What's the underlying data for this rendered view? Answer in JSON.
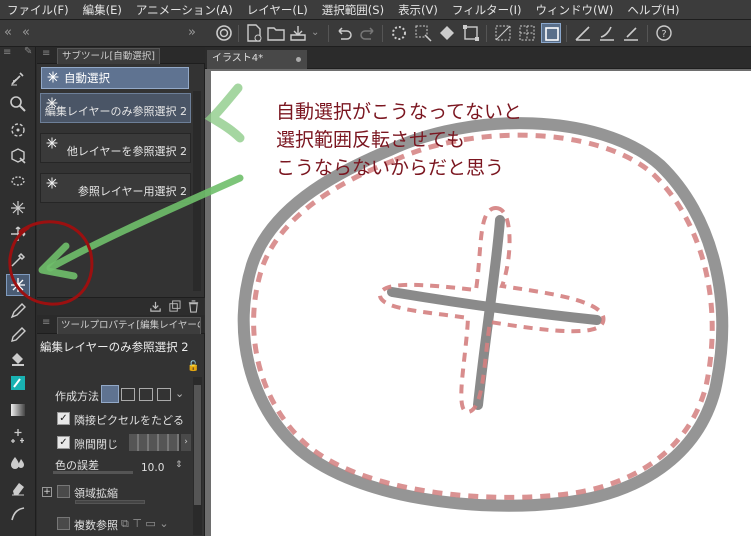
{
  "menu": [
    "ファイル(F)",
    "編集(E)",
    "アニメーション(A)",
    "レイヤー(L)",
    "選択範囲(S)",
    "表示(V)",
    "フィルター(I)",
    "ウィンドウ(W)",
    "ヘルプ(H)"
  ],
  "subtool_panel": {
    "tab_label": "サブツール[自動選択]",
    "group_label": "自動選択",
    "items": [
      {
        "label": "編集レイヤーのみ参照選択 2",
        "selected": true
      },
      {
        "label": "他レイヤーを参照選択 2",
        "selected": false
      },
      {
        "label": "参照レイヤー用選択 2",
        "selected": false
      }
    ]
  },
  "tool_property": {
    "tab_label": "ツールプロパティ[編集レイヤーの",
    "title": "編集レイヤーのみ参照選択 2",
    "mode_label": "作成方法",
    "follow_adjacent_label": "隣接ピクセルをたどる",
    "follow_adjacent_checked": true,
    "close_gap_label": "隙間閉じ",
    "close_gap_checked": true,
    "color_margin_label": "色の誤差",
    "color_margin_value": "10.0",
    "expand_area_label": "領域拡縮",
    "expand_area_checked": false,
    "multi_ref_label": "複数参照",
    "multi_ref_checked": false
  },
  "document": {
    "tab_title": "イラスト4*"
  },
  "annotation": {
    "lines": [
      "自動選択がこうなってないと",
      "選択範囲反転させても",
      "こうならないからだと思う"
    ],
    "color": "#7b1620"
  },
  "colors": {
    "accent": "#5f7391",
    "marker_green": "#6fbf6a",
    "marker_red": "#9b1010",
    "stroke_gray": "#8a8a8a",
    "selection_pink": "#d47f7f"
  }
}
